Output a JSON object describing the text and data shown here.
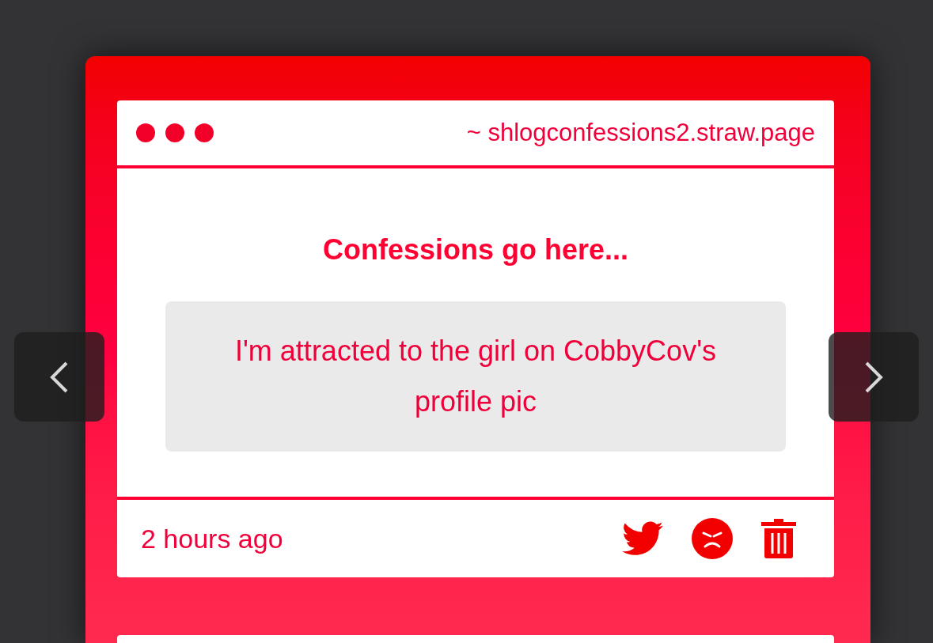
{
  "card": {
    "address": "~ shlogconfessions2.straw.page",
    "heading": "Confessions go here...",
    "confession": "I'm attracted to the girl on CobbyCov's profile pic",
    "time": "2 hours ago"
  }
}
